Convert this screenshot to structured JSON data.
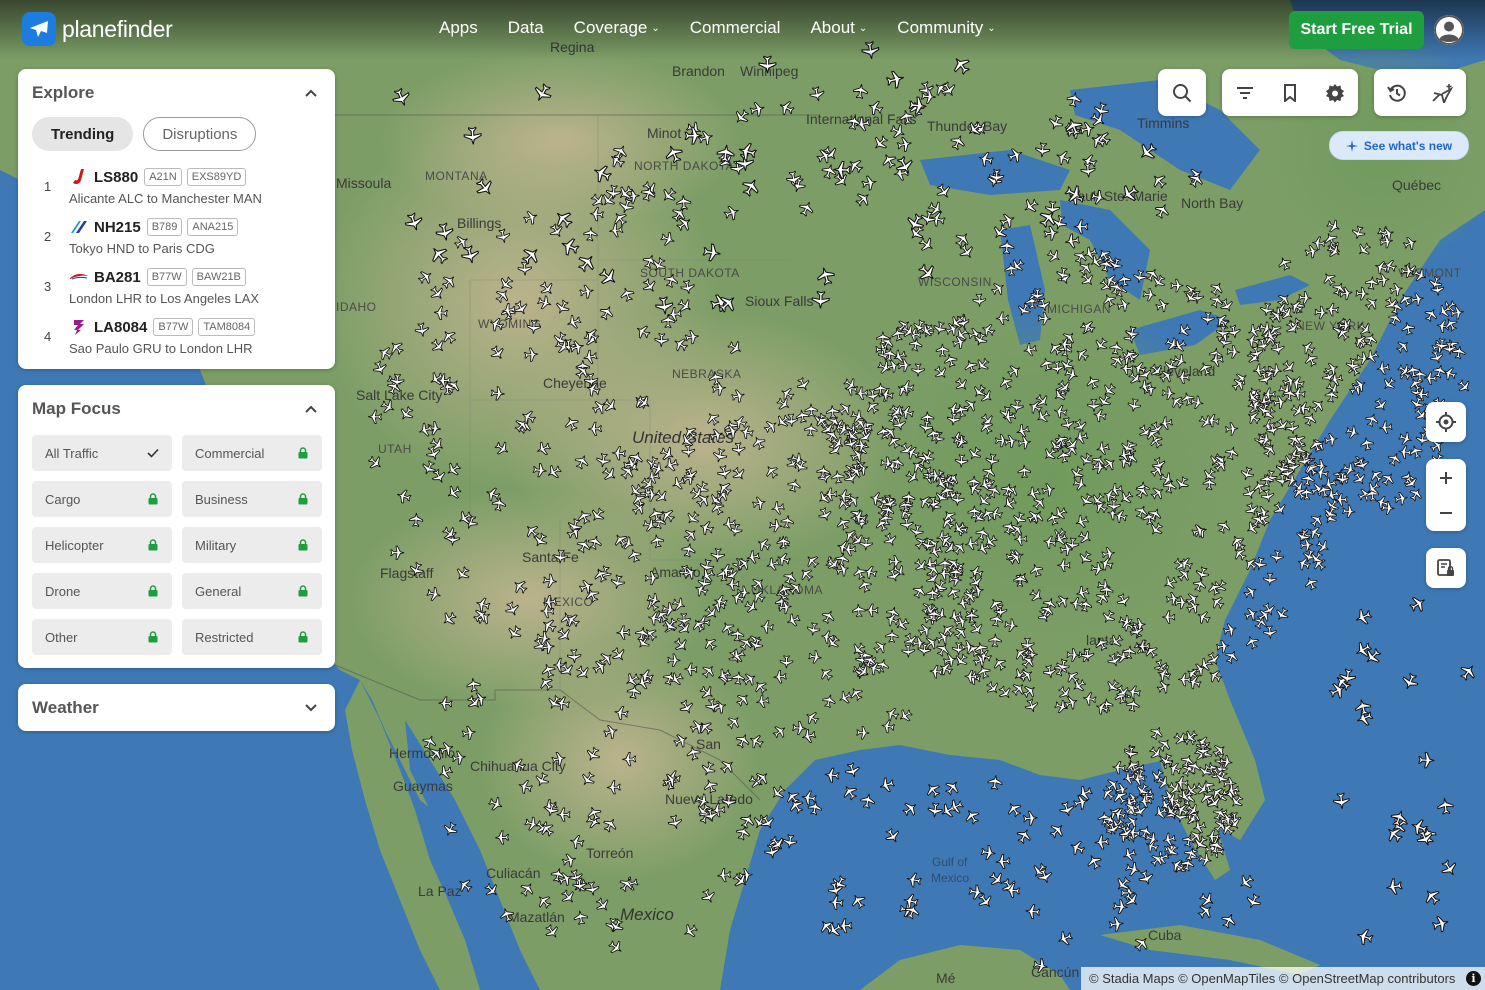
{
  "brand": {
    "name_bold": "plane",
    "name_light": "finder"
  },
  "nav": {
    "items": [
      {
        "label": "Apps",
        "has_menu": false
      },
      {
        "label": "Data",
        "has_menu": false
      },
      {
        "label": "Coverage",
        "has_menu": true
      },
      {
        "label": "Commercial",
        "has_menu": false
      },
      {
        "label": "About",
        "has_menu": true
      },
      {
        "label": "Community",
        "has_menu": true
      }
    ],
    "trial_label": "Start Free Trial",
    "accent": "#1e9e3e"
  },
  "explore": {
    "title": "Explore",
    "tabs": [
      "Trending",
      "Disruptions"
    ],
    "active_tab": "Trending",
    "trending": [
      {
        "rank": "1",
        "flight": "LS880",
        "aircraft": "A21N",
        "callsign": "EXS89YD",
        "route": "Alicante ALC to Manchester MAN",
        "airline_color": "#d5141c"
      },
      {
        "rank": "2",
        "flight": "NH215",
        "aircraft": "B789",
        "callsign": "ANA215",
        "route": "Tokyo HND to Paris CDG",
        "airline_color": "#1b3f9a"
      },
      {
        "rank": "3",
        "flight": "BA281",
        "aircraft": "B77W",
        "callsign": "BAW21B",
        "route": "London LHR to Los Angeles LAX",
        "airline_color": "#c8102e"
      },
      {
        "rank": "4",
        "flight": "LA8084",
        "aircraft": "B77W",
        "callsign": "TAM8084",
        "route": "Sao Paulo GRU to London LHR",
        "airline_color": "#9b1b8e"
      }
    ]
  },
  "map_focus": {
    "title": "Map Focus",
    "options": [
      {
        "label": "All Traffic",
        "state": "selected"
      },
      {
        "label": "Commercial",
        "state": "locked"
      },
      {
        "label": "Cargo",
        "state": "locked"
      },
      {
        "label": "Business",
        "state": "locked"
      },
      {
        "label": "Helicopter",
        "state": "locked"
      },
      {
        "label": "Military",
        "state": "locked"
      },
      {
        "label": "Drone",
        "state": "locked"
      },
      {
        "label": "General",
        "state": "locked"
      },
      {
        "label": "Other",
        "state": "locked"
      },
      {
        "label": "Restricted",
        "state": "locked"
      }
    ],
    "lock_color": "#1e9e3e"
  },
  "weather": {
    "title": "Weather"
  },
  "whats_new": {
    "label": "See what's new"
  },
  "map": {
    "labels": {
      "regina": "Regina",
      "brandon": "Brandon",
      "winnipeg": "Winnipeg",
      "minot": "Minot",
      "international_falls": "International Falls",
      "thunder_bay": "Thunder Bay",
      "timmins": "Timmins",
      "montana": "MONTANA",
      "north_dakota": "NORTH DAKOTA",
      "missoula": "Missoula",
      "billings": "Billings",
      "sault": "Sault Ste. Marie",
      "north_bay": "North Bay",
      "quebec": "Québec",
      "south_dakota": "SOUTH DAKOTA",
      "wisconsin": "WISCONSIN",
      "sioux_falls": "Sioux Falls",
      "wyoming": "WYOMING",
      "idaho": "IDAHO",
      "michigan": "MICHIGAN",
      "new_york": "NEW YORK",
      "vermont": "VERMONT",
      "nebraska": "NEBRASKA",
      "cheyenne": "Cheyenne",
      "salt_lake": "Salt Lake City",
      "utah": "UTAH",
      "united_states": "United States",
      "santa_fe": "Santa Fe",
      "flagstaff": "Flagstaff",
      "amarillo": "Amarillo",
      "new_mexico": "MEXICO",
      "oklahoma": "OKLAHOMA",
      "hermosillo": "Hermosillo",
      "chihuahua": "Chihuahua City",
      "guaymas": "Guaymas",
      "san_antonio": "San",
      "nuevo_laredo": "Nuevo Laredo",
      "torreon": "Torreón",
      "culiacan": "Culiacán",
      "la_paz": "La Paz",
      "mazatlan": "Mazatlán",
      "mexico": "Mexico",
      "gulf_1": "Gulf of",
      "gulf_2": "Mexico",
      "cuba": "Cuba",
      "cancun": "Cancún",
      "mexico_city": "Mé",
      "cleveland": "Cleveland",
      "lanta": "lanta"
    },
    "land": "#7a9b62",
    "land_dry": "#b8ad8b",
    "water": "#3f79b5",
    "aircraft_seed": 1729
  },
  "attribution": "© Stadia Maps © OpenMapTiles © OpenStreetMap contributors"
}
